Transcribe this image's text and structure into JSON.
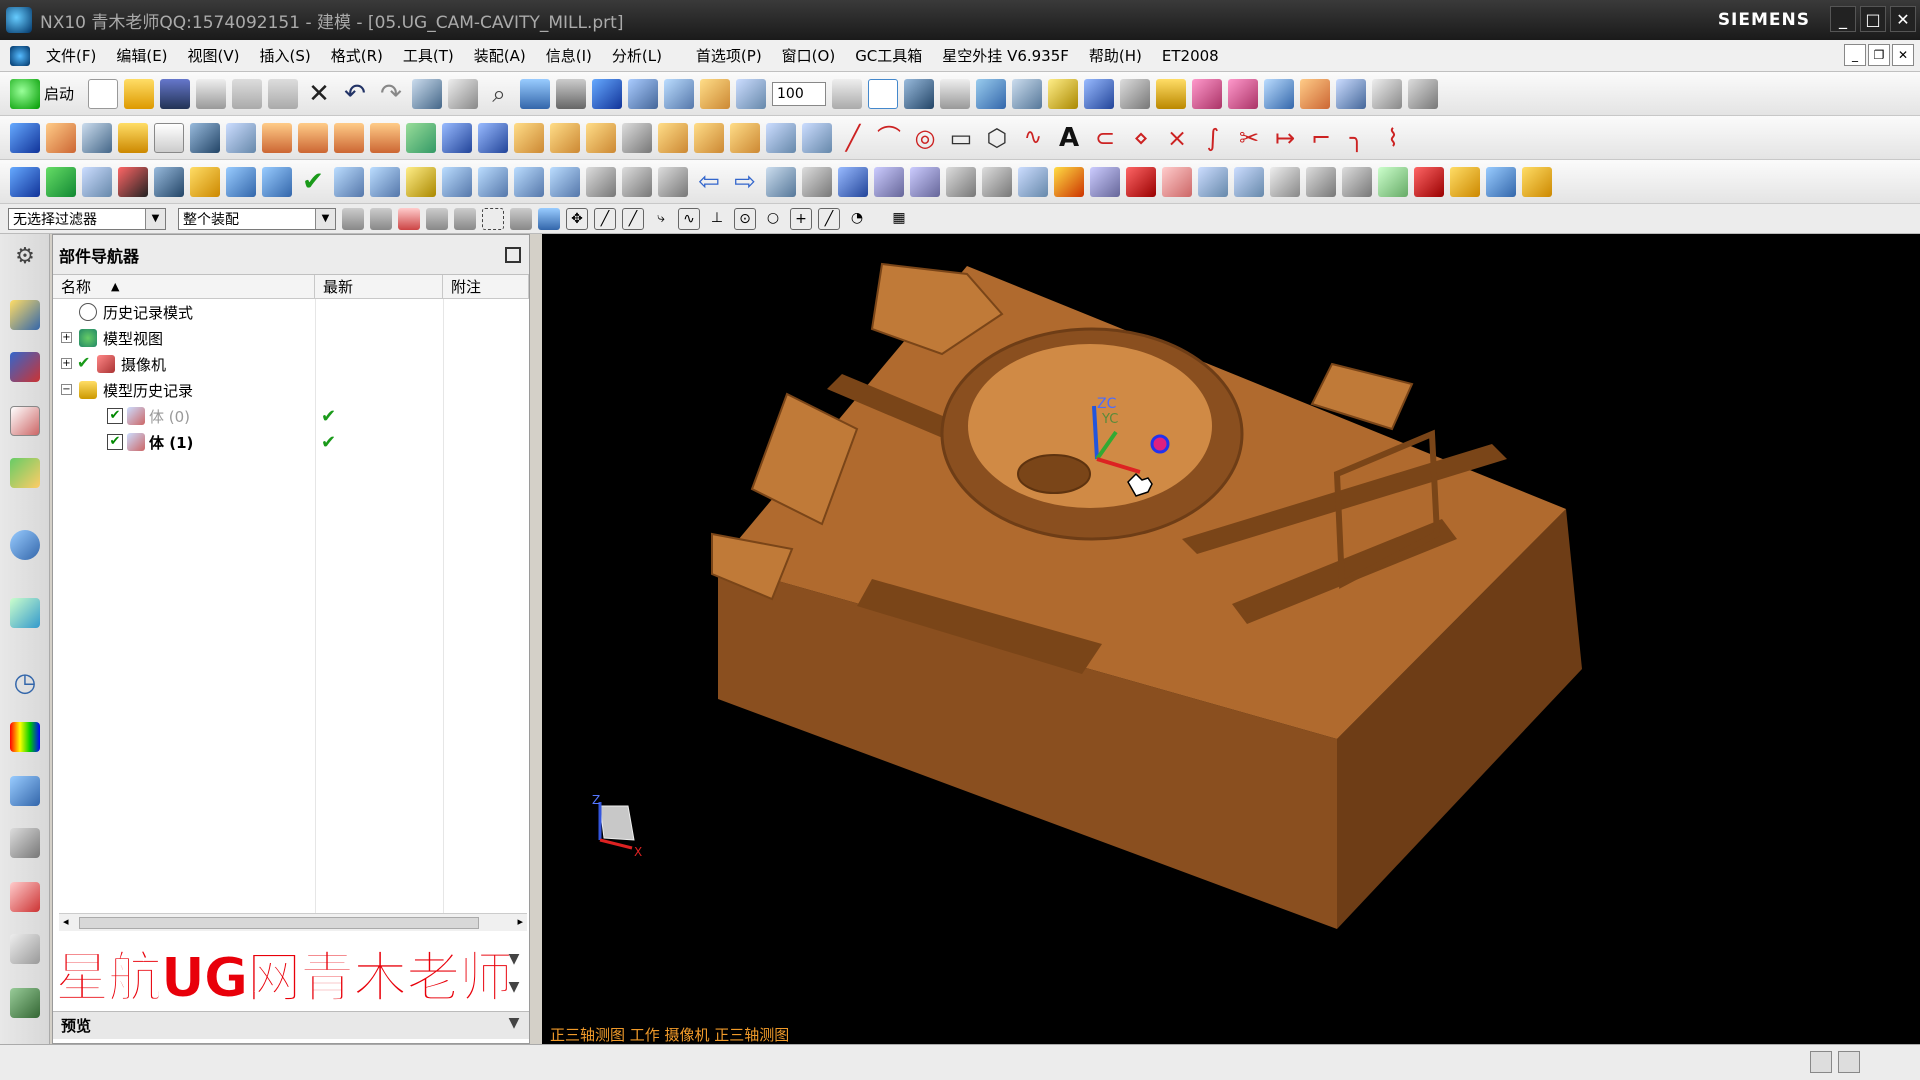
{
  "window": {
    "title": "NX10 青木老师QQ:1574092151 - 建模 - [05.UG_CAM-CAVITY_MILL.prt]",
    "brand": "SIEMENS",
    "controls": [
      "_",
      "□",
      "✕"
    ]
  },
  "menu": {
    "items": [
      "文件(F)",
      "编辑(E)",
      "视图(V)",
      "插入(S)",
      "格式(R)",
      "工具(T)",
      "装配(A)",
      "信息(I)",
      "分析(L)",
      "首选项(P)",
      "窗口(O)",
      "GC工具箱",
      "星空外挂 V6.935F",
      "帮助(H)",
      "ET2008"
    ]
  },
  "toolbar": {
    "start_label": "启动",
    "zoom_value": "100"
  },
  "filter_bar": {
    "selection_filter": "无选择过滤器",
    "scope": "整个装配"
  },
  "navigator": {
    "title": "部件导航器",
    "columns": {
      "name": "名称",
      "latest": "最新",
      "note": "附注"
    },
    "rows": [
      {
        "label": "历史记录模式"
      },
      {
        "label": "模型视图"
      },
      {
        "label": "摄像机"
      },
      {
        "label": "模型历史记录"
      },
      {
        "label": "体 (0)"
      },
      {
        "label": "体 (1)"
      }
    ],
    "latest_mark": "✔",
    "watermark": "星航UG网青木老师",
    "preview": "预览"
  },
  "viewport": {
    "status": "正三轴测图 工作 摄像机 正三轴测图",
    "axis_labels": {
      "zc": "ZC",
      "yc": "YC",
      "x": "X",
      "z": "Z"
    },
    "part_color": "#b06a2e",
    "background": "#000000"
  },
  "colors": {
    "titlebar": "#222222",
    "watermark_red": "#e8000a",
    "check_green": "#1a9a1a",
    "status_orange": "#f09a2a"
  }
}
